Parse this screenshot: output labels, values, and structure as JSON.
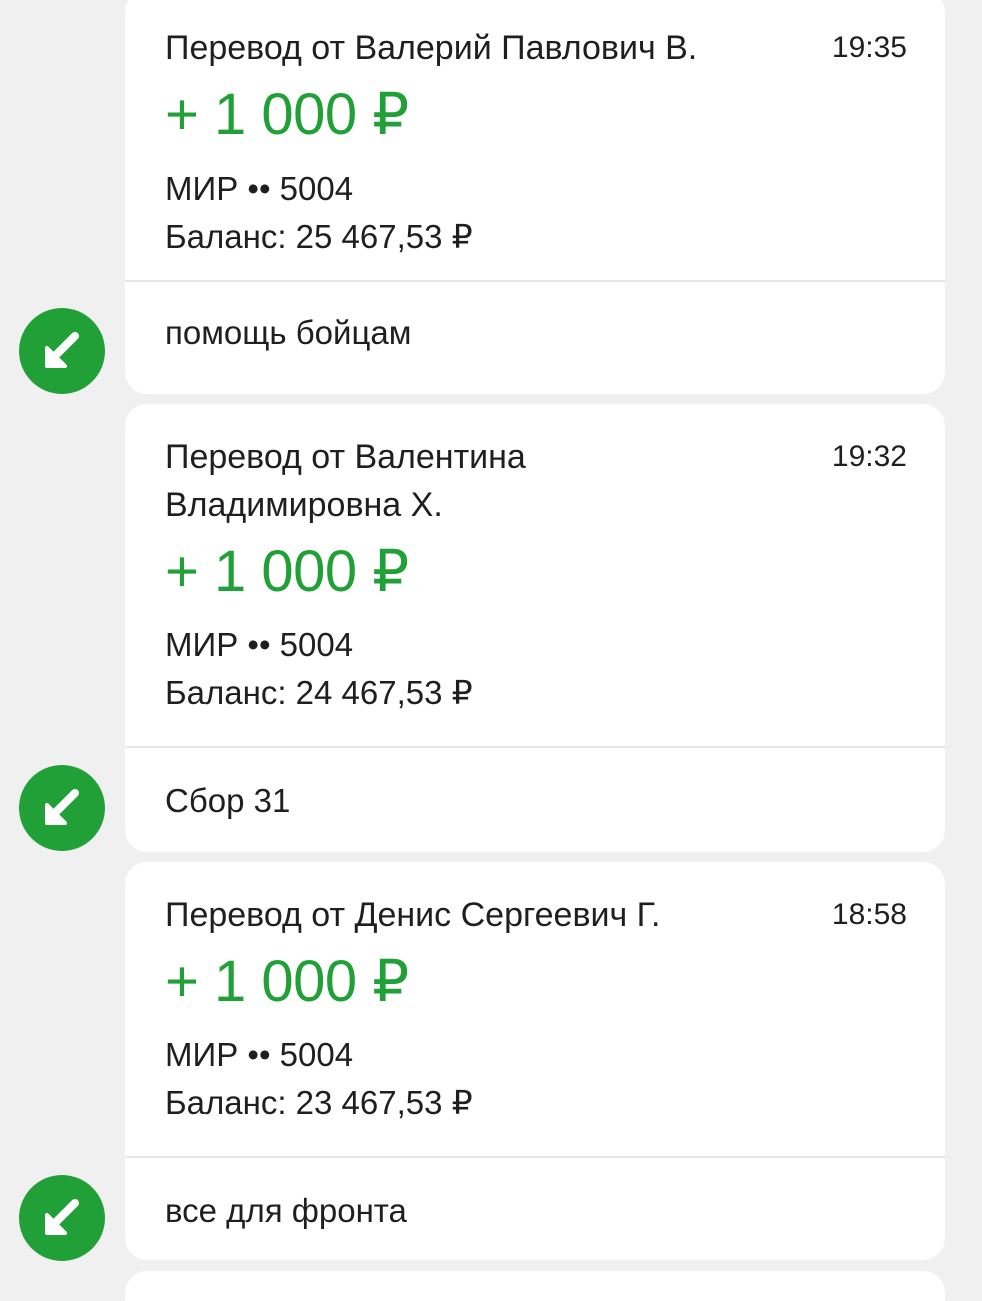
{
  "transactions": [
    {
      "sender": "Перевод от Валерий Павлович В.",
      "time": "19:35",
      "amount": "+ 1 000 ₽",
      "card": "МИР •• 5004",
      "balance": "Баланс: 25 467,53 ₽",
      "comment": "помощь бойцам"
    },
    {
      "sender": "Перевод от Валентина Владимировна Х.",
      "time": "19:32",
      "amount": "+ 1 000 ₽",
      "card": "МИР •• 5004",
      "balance": "Баланс: 24 467,53 ₽",
      "comment": "Сбор 31"
    },
    {
      "sender": "Перевод от Денис Сергеевич Г.",
      "time": "18:58",
      "amount": "+ 1 000 ₽",
      "card": "МИР •• 5004",
      "balance": "Баланс: 23 467,53 ₽",
      "comment": "все для фронта"
    }
  ],
  "icons": {
    "incoming": "arrow-down-left-icon"
  },
  "colors": {
    "accent_green": "#21a038",
    "background": "#f0f0f0",
    "card": "#ffffff"
  }
}
